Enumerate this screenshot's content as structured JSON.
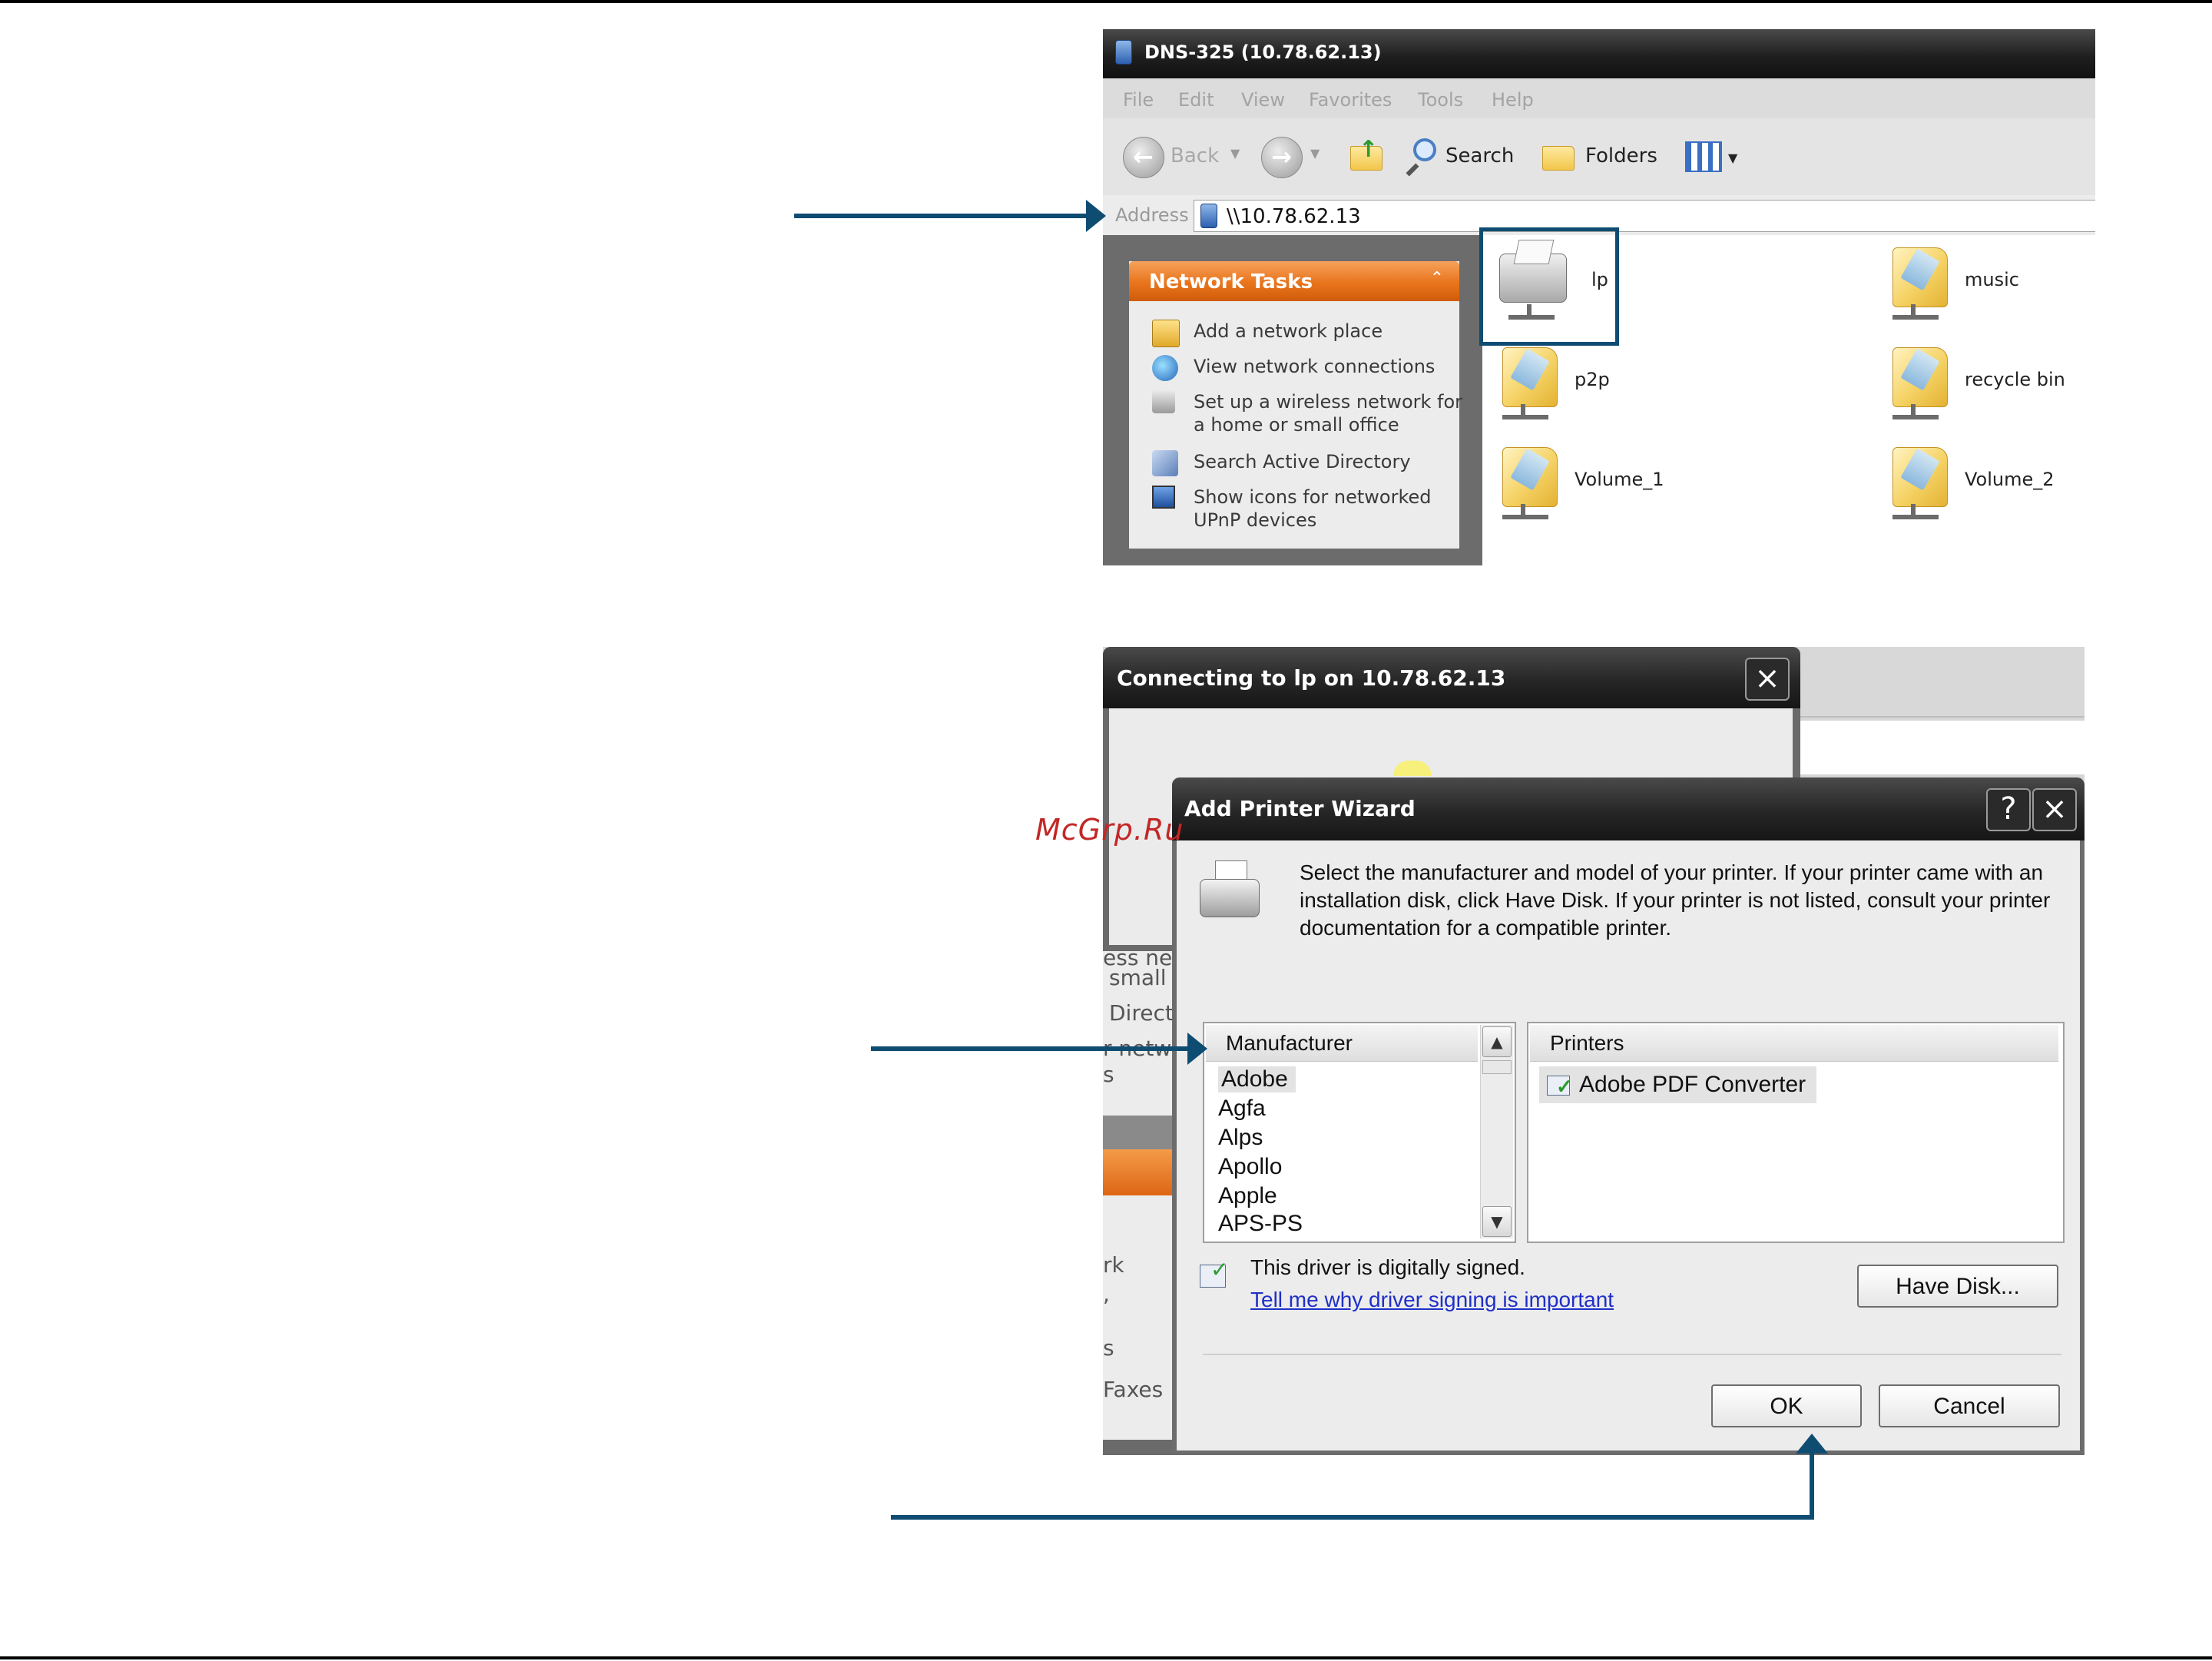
{
  "explorer": {
    "title": "DNS-325 (10.78.62.13)",
    "menu": [
      "File",
      "Edit",
      "View",
      "Favorites",
      "Tools",
      "Help"
    ],
    "toolbar": {
      "back_label": "Back",
      "search_label": "Search",
      "folders_label": "Folders"
    },
    "address_label": "Address",
    "address_value": "\\\\10.78.62.13",
    "network_tasks": {
      "title": "Network Tasks",
      "items": [
        {
          "label": "Add a network place",
          "icon": "add-network-place-icon"
        },
        {
          "label": "View network connections",
          "icon": "network-connections-icon"
        },
        {
          "label": "Set up a wireless network for a home or small office",
          "icon": "wireless-setup-icon"
        },
        {
          "label": "Search Active Directory",
          "icon": "search-directory-icon"
        },
        {
          "label": "Show icons for networked UPnP devices",
          "icon": "upnp-devices-icon"
        }
      ]
    },
    "shares": [
      {
        "label": "lp",
        "icon": "printer-share-icon"
      },
      {
        "label": "music",
        "icon": "shared-folder-icon"
      },
      {
        "label": "p2p",
        "icon": "shared-folder-icon"
      },
      {
        "label": "recycle bin",
        "icon": "shared-folder-icon"
      },
      {
        "label": "Volume_1",
        "icon": "shared-folder-icon"
      },
      {
        "label": "Volume_2",
        "icon": "shared-folder-icon"
      }
    ]
  },
  "connecting_dialog": {
    "title": "Connecting to lp on 10.78.62.13"
  },
  "background_fragments": {
    "lines": [
      "ess ne",
      "small",
      "Direct",
      "r netw",
      "s",
      "rk",
      ",",
      "s",
      "Faxes"
    ]
  },
  "wizard": {
    "title": "Add Printer Wizard",
    "help_glyph": "?",
    "instructions": "Select the manufacturer and model of your printer. If your printer came with an installation disk, click Have Disk. If your printer is not listed, consult your printer documentation for a compatible printer.",
    "manufacturer_header": "Manufacturer",
    "manufacturers": [
      "Adobe",
      "Agfa",
      "Alps",
      "Apollo",
      "Apple",
      "APS-PS"
    ],
    "selected_manufacturer": "Adobe",
    "printers_header": "Printers",
    "printers": [
      "Adobe PDF Converter"
    ],
    "signed_text": "This driver is digitally signed.",
    "signing_link": "Tell me why driver signing is important",
    "have_disk_label": "Have Disk...",
    "ok_label": "OK",
    "cancel_label": "Cancel"
  },
  "watermark": "McGrp.Ru",
  "colors": {
    "callout": "#0f4c72",
    "tasks_header": "#e8741c",
    "link": "#1f2fc7",
    "watermark": "#c22727"
  }
}
